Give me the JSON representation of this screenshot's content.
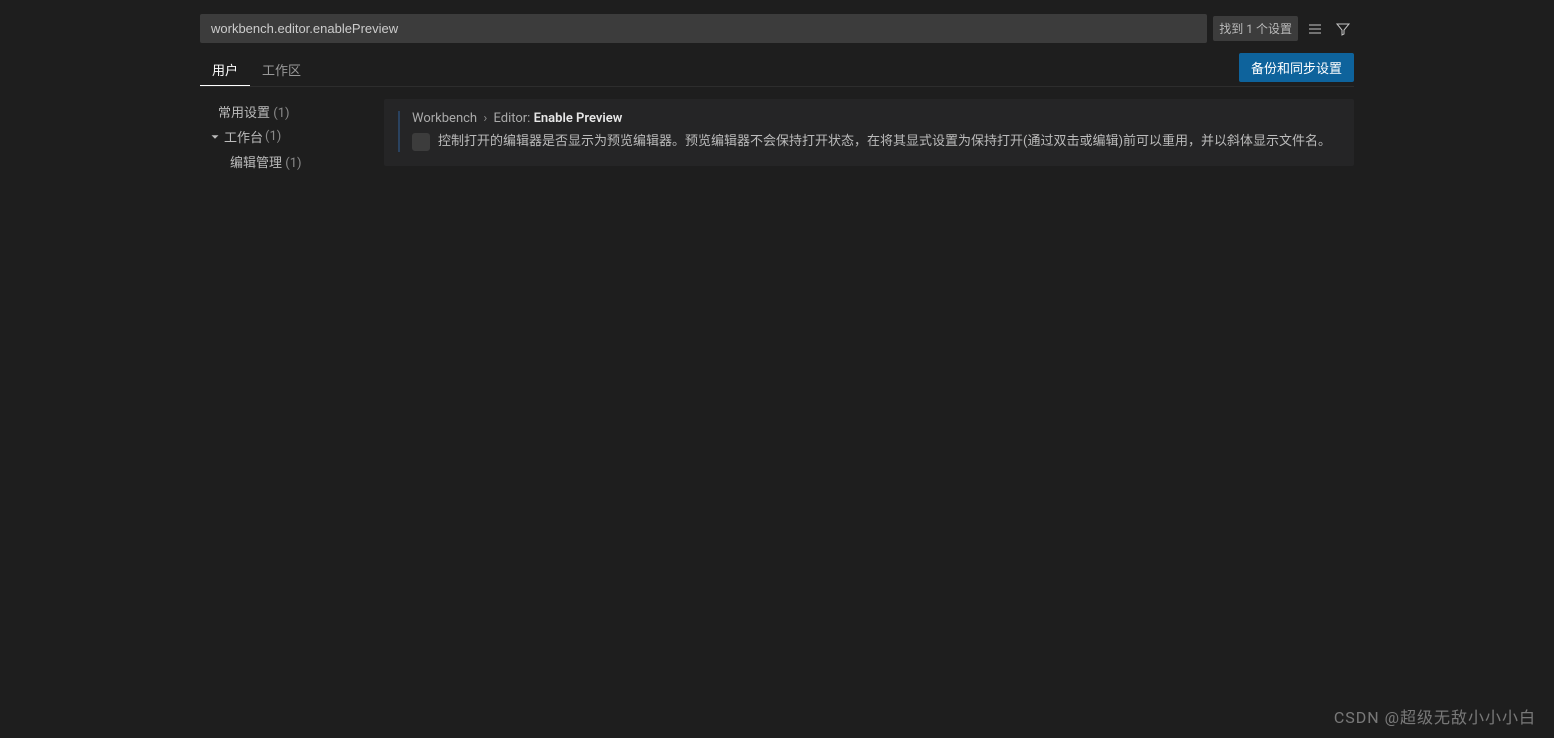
{
  "search": {
    "value": "workbench.editor.enablePreview",
    "result_count": "找到 1 个设置"
  },
  "tabs": {
    "user": "用户",
    "workspace": "工作区"
  },
  "sync_button": "备份和同步设置",
  "toc": {
    "common": {
      "label": "常用设置",
      "count": "(1)"
    },
    "workbench": {
      "label": "工作台",
      "count": "(1)"
    },
    "editor_mgmt": {
      "label": "编辑管理",
      "count": "(1)"
    }
  },
  "setting": {
    "breadcrumb1": "Workbench",
    "breadcrumb2": "Editor:",
    "name": "Enable Preview",
    "description": "控制打开的编辑器是否显示为预览编辑器。预览编辑器不会保持打开状态，在将其显式设置为保持打开(通过双击或编辑)前可以重用，并以斜体显示文件名。"
  },
  "watermark": "CSDN @超级无敌小小小白"
}
